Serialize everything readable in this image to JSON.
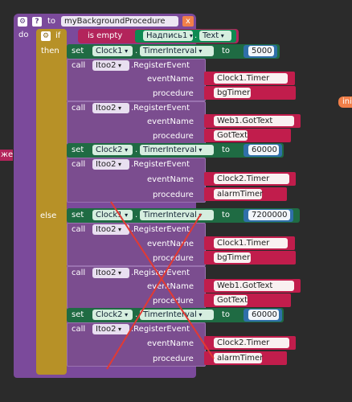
{
  "header": {
    "to_label": "to",
    "procedure_name": "myBackgroundProcedure",
    "close_label": "x",
    "do_label": "do"
  },
  "if_block": {
    "if_label": "if",
    "is_empty": "is empty",
    "component": "Надпись1",
    "property": "Text",
    "then_label": "then",
    "else_label": "else"
  },
  "blocks": {
    "set": "set",
    "to": "to",
    "call": "call",
    "dot_timerinterval": "TimerInterval",
    "register": ".RegisterEvent",
    "eventName": "eventName",
    "procedure": "procedure"
  },
  "then_branch": {
    "set1": {
      "comp": "Clock1",
      "value": "5000"
    },
    "call1": {
      "comp": "Itoo2",
      "event": "Clock1.Timer",
      "proc": "bgTimer"
    },
    "call2": {
      "comp": "Itoo2",
      "event": "Web1.GotText",
      "proc": "GotText"
    },
    "set2": {
      "comp": "Clock2",
      "value": "60000"
    },
    "call3": {
      "comp": "Itoo2",
      "event": "Clock2.Timer",
      "proc": "alarmTimer"
    }
  },
  "else_branch": {
    "set1": {
      "comp": "Clock1",
      "value": "7200000"
    },
    "call1": {
      "comp": "Itoo2",
      "event": "Clock1.Timer",
      "proc": "bgTimer"
    },
    "call2": {
      "comp": "Itoo2",
      "event": "Web1.GotText",
      "proc": "GotText"
    },
    "set2": {
      "comp": "Clock2",
      "value": "60000"
    },
    "call3": {
      "comp": "Itoo2",
      "event": "Clock2.Timer",
      "proc": "alarmTimer"
    }
  },
  "edge_fragments": {
    "left": "жен",
    "right": "ini"
  },
  "colors": {
    "background": "#2b2b2b",
    "procedure": "#7b4a9b",
    "control": "#b79127",
    "set_block": "#1f6b43",
    "string": "#c11d4c",
    "number": "#2f6fa9",
    "strike_lines": "#e23a33"
  }
}
